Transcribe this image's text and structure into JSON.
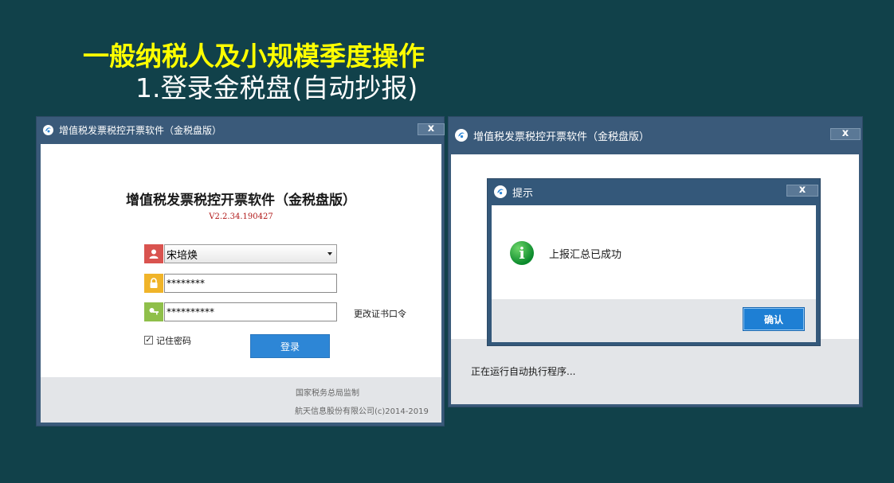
{
  "slide": {
    "title": "一般纳税人及小规模季度操作",
    "subtitle": "1.登录金税盘(自动抄报)"
  },
  "login_window": {
    "titlebar": "增值税发票税控开票软件（金税盘版）",
    "close": "x",
    "heading": "增值税发票税控开票软件（金税盘版）",
    "version": "V2.2.34.190427",
    "user_value": "宋培焕",
    "password_value": "********",
    "cert_value": "**********",
    "change_cert_link": "更改证书口令",
    "remember_label": "记住密码",
    "remember_checked": true,
    "login_label": "登录",
    "footer_line1": "国家税务总局监制",
    "footer_line2": "航天信息股份有限公司(c)2014-2019"
  },
  "status_window": {
    "titlebar": "增值税发票税控开票软件（金税盘版）",
    "close": "x",
    "status_text": "正在运行自动执行程序..."
  },
  "dialog": {
    "titlebar": "提示",
    "close": "x",
    "message": "上报汇总已成功",
    "ok_label": "确认"
  },
  "icons": {
    "user": "user-icon",
    "lock": "lock-icon",
    "key": "key-icon",
    "app": "app-logo-icon",
    "info": "info-icon"
  },
  "colors": {
    "background": "#11414a",
    "title_yellow": "#ffff00",
    "window_frame": "#3a5a7a",
    "button_blue": "#2d86d6",
    "version_red": "#b01818",
    "info_green": "#0b8a2c"
  }
}
